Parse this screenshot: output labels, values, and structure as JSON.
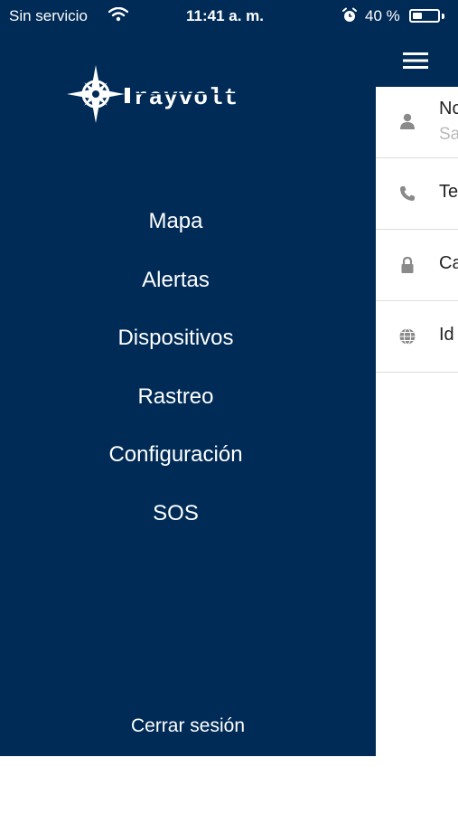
{
  "status_bar": {
    "carrier": "Sin servicio",
    "time": "11:41 a. m.",
    "battery_percent": "40 %",
    "battery_level": 0.4,
    "icons": [
      "wifi-icon",
      "alarm-clock-icon",
      "battery-icon"
    ]
  },
  "brand": {
    "logo_text": "rayvolt",
    "logo_icon": "compass-star-icon"
  },
  "drawer": {
    "menu_items": [
      {
        "label": "Mapa"
      },
      {
        "label": "Alertas"
      },
      {
        "label": "Dispositivos"
      },
      {
        "label": "Rastreo"
      },
      {
        "label": "Configuración"
      },
      {
        "label": "SOS"
      }
    ],
    "logout_label": "Cerrar sesión"
  },
  "content": {
    "header_icon": "hamburger-menu-icon",
    "rows": [
      {
        "icon": "user-icon",
        "label": "No",
        "sublabel": "Sa"
      },
      {
        "icon": "phone-icon",
        "label": "Te"
      },
      {
        "icon": "lock-icon",
        "label": "Ca"
      },
      {
        "icon": "globe-icon",
        "label": "Id"
      }
    ]
  },
  "colors": {
    "drawer_background": "#002b56",
    "text_on_dark": "#ffffff",
    "divider": "#dcdcdc",
    "icon_gray": "#8a8a8a",
    "sublabel_gray": "#b9b9b9"
  }
}
